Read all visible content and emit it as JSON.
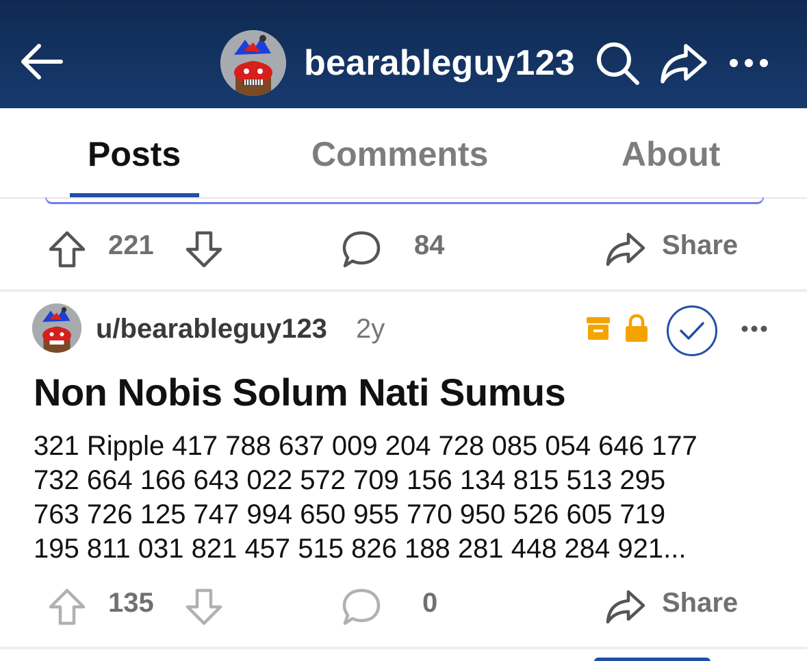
{
  "header": {
    "title": "bearableguy123",
    "icons": [
      "back-arrow-icon",
      "search-icon",
      "share-icon",
      "more-icon"
    ],
    "bg_color": "#173a6e"
  },
  "tabs": [
    {
      "label": "Posts",
      "active": true
    },
    {
      "label": "Comments",
      "active": false
    },
    {
      "label": "About",
      "active": false
    }
  ],
  "previous_post": {
    "upvotes": "221",
    "comments": "84",
    "share_label": "Share"
  },
  "post": {
    "author": "u/bearableguy123",
    "age": "2y",
    "title": "Non Nobis Solum Nati Sumus",
    "body_lines": [
      "321 Ripple 417 788 637 009 204 728 085 054 646 177",
      "732 664 166 643 022 572 709 156 134 815 513 295",
      "763 726 125 747 994 650 955 770 950 526 605 719",
      "195 811 031 821 457 515 826 188 281 448 284 921..."
    ],
    "upvotes": "135",
    "comments": "0",
    "share_label": "Share",
    "status_icons": [
      "archive-icon",
      "lock-icon",
      "approve-check-icon"
    ],
    "status_color": "#f5a300",
    "accent_color": "#2250a8"
  }
}
